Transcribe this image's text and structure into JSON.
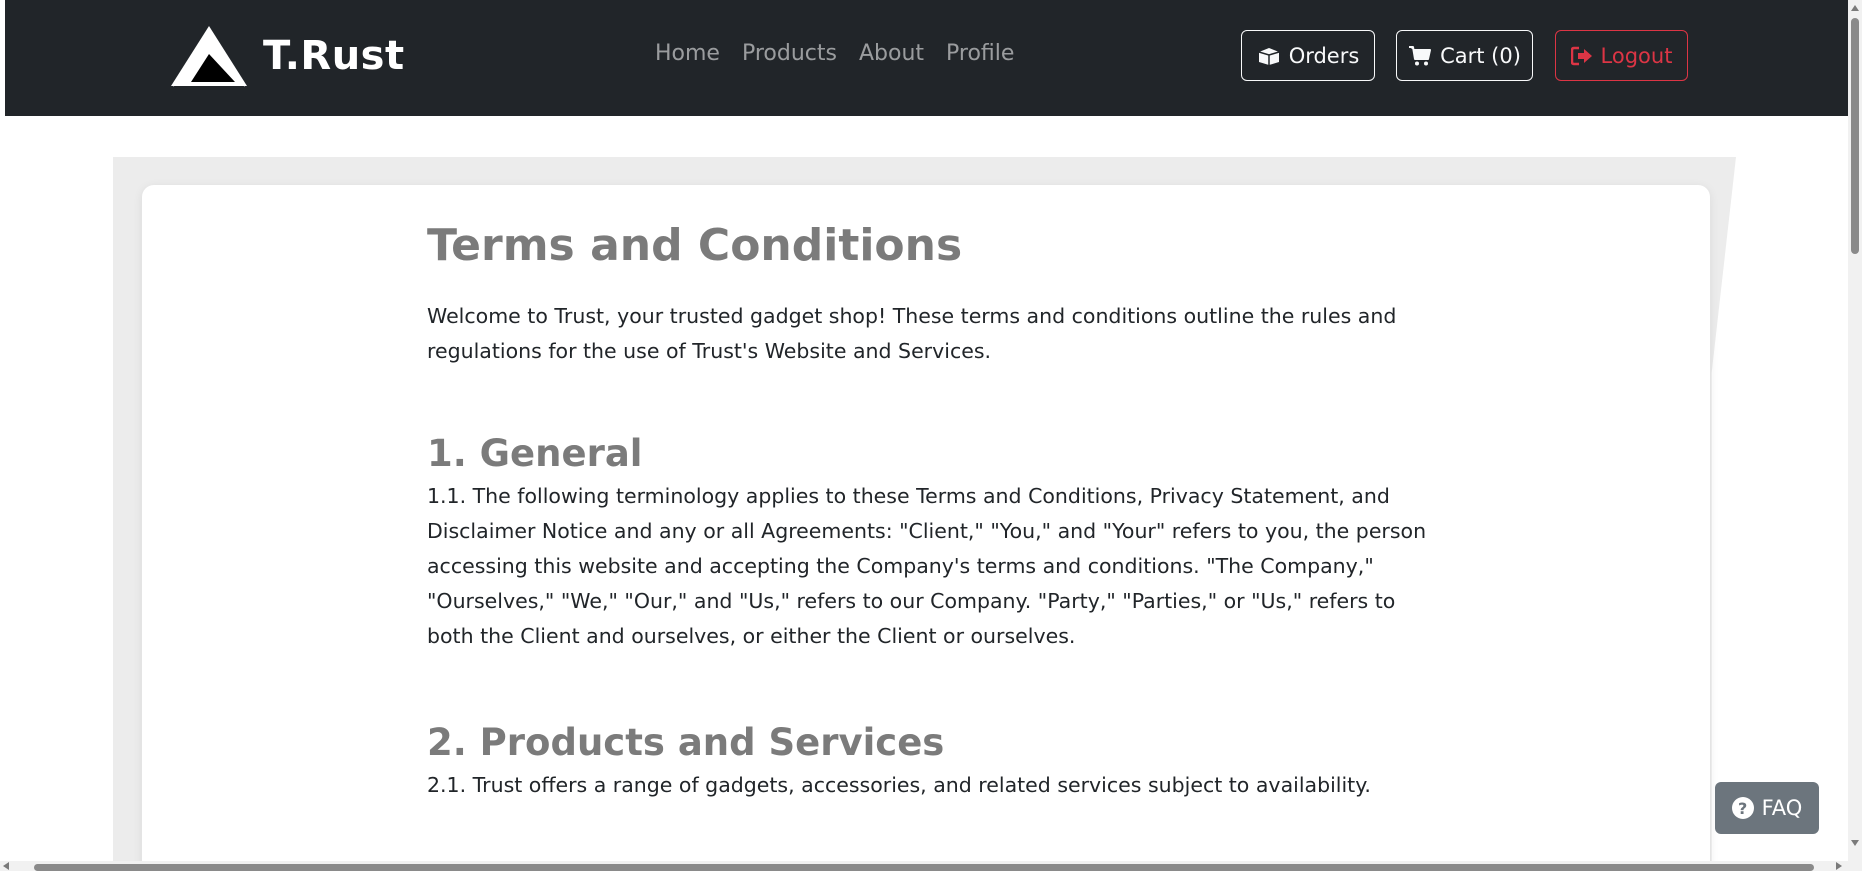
{
  "navbar": {
    "brand": {
      "name": "T.Rust",
      "logo_icon": "mountain-logo"
    },
    "links": [
      "Home",
      "Products",
      "About",
      "Profile"
    ],
    "buttons": {
      "orders": {
        "label": "Orders",
        "icon": "box-icon"
      },
      "cart": {
        "label": "Cart (0)",
        "icon": "cart-icon"
      },
      "logout": {
        "label": "Logout",
        "icon": "sign-out-icon",
        "color": "#dc3545"
      }
    }
  },
  "content": {
    "title": "Terms and Conditions",
    "intro": "Welcome to Trust, your trusted gadget shop! These terms and conditions outline the rules and regulations for the use of Trust's Website and Services.",
    "sections": [
      {
        "heading": "1. General",
        "text": "1.1. The following terminology applies to these Terms and Conditions, Privacy Statement, and Disclaimer Notice and any or all Agreements: \"Client,\" \"You,\" and \"Your\" refers to you, the person accessing this website and accepting the Company's terms and conditions. \"The Company,\" \"Ourselves,\" \"We,\" \"Our,\" and \"Us,\" refers to our Company. \"Party,\" \"Parties,\" or \"Us,\" refers to both the Client and ourselves, or either the Client or ourselves."
      },
      {
        "heading": "2. Products and Services",
        "text": "2.1. Trust offers a range of gadgets, accessories, and related services subject to availability."
      }
    ]
  },
  "faq": {
    "label": "FAQ",
    "icon": "question-circle-icon"
  },
  "colors": {
    "navbar_bg": "#212529",
    "heading": "#7b7b7b",
    "faq_bg": "#6c757d",
    "danger": "#dc3545"
  }
}
